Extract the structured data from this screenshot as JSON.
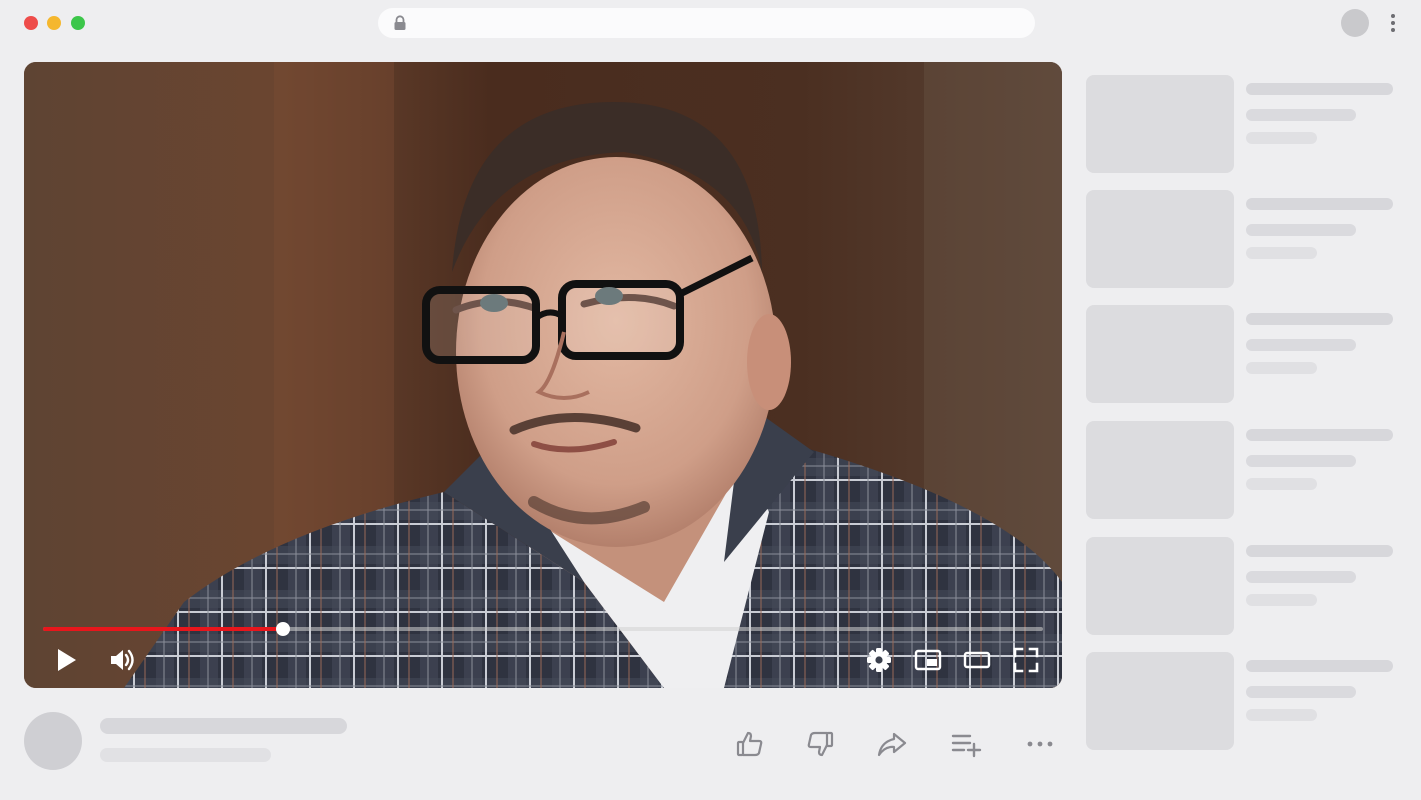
{
  "colors": {
    "page_bg": "#eeeef0",
    "traffic_red": "#ee4c4a",
    "traffic_yellow": "#f5b72e",
    "traffic_green": "#3cc64a",
    "progress_played": "#e8161c",
    "icon_gray": "#8a8a90"
  },
  "browser": {
    "window_controls": [
      "close",
      "minimize",
      "maximize"
    ],
    "address_icon": "lock-icon",
    "menu_icon": "more-vertical-icon"
  },
  "player": {
    "progress_fraction": 0.24,
    "controls_left": [
      "play-icon",
      "volume-icon"
    ],
    "controls_right": [
      "settings-icon",
      "miniplayer-icon",
      "theater-mode-icon",
      "fullscreen-icon"
    ]
  },
  "actions": [
    "like-icon",
    "dislike-icon",
    "share-icon",
    "save-to-playlist-icon",
    "more-horizontal-icon"
  ],
  "recommendations_count": 6
}
